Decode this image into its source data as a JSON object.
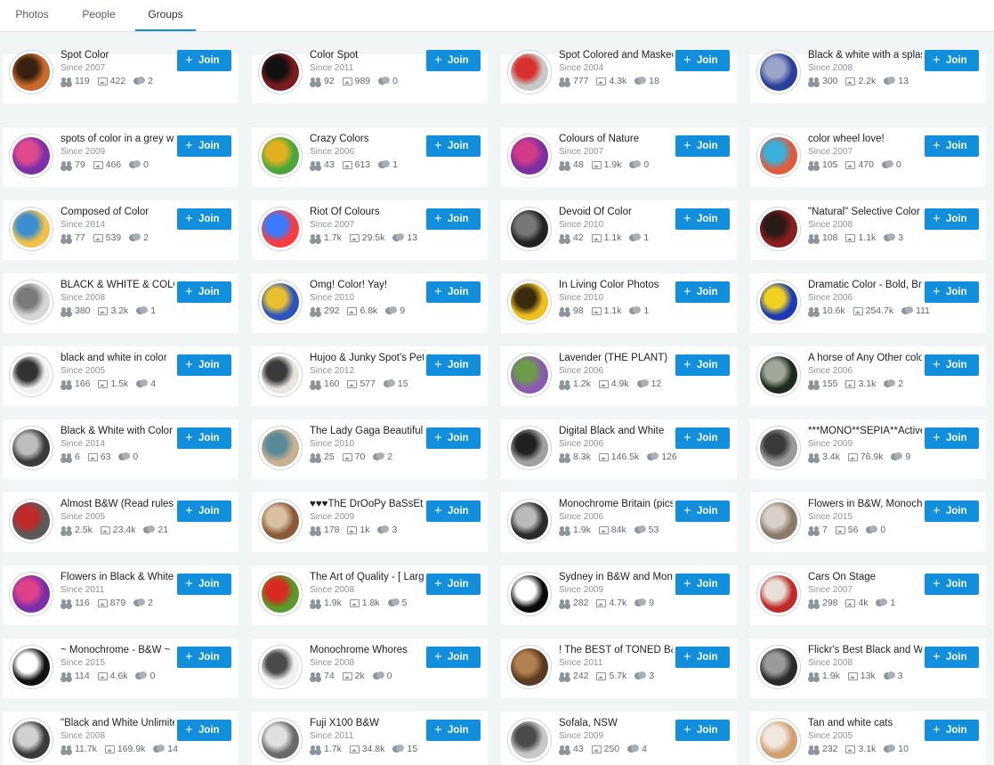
{
  "tabs": [
    {
      "label": "Photos",
      "active": false
    },
    {
      "label": "People",
      "active": false
    },
    {
      "label": "Groups",
      "active": true
    }
  ],
  "join_label": "Join",
  "accent_color": "#128fdc",
  "groups": [
    {
      "name": "Spot Color",
      "since": "Since 2007",
      "members": "119",
      "photos": "422",
      "discussions": "2",
      "avatar": [
        "#c96a2a",
        "#3a2010"
      ]
    },
    {
      "name": "Color Spot",
      "since": "Since 2011",
      "members": "92",
      "photos": "989",
      "discussions": "0",
      "avatar": [
        "#7a1c1c",
        "#111111"
      ]
    },
    {
      "name": "Spot Colored and Masked",
      "since": "Since 2004",
      "members": "777",
      "photos": "4.3k",
      "discussions": "18",
      "avatar": [
        "#c8c8c8",
        "#d8302f"
      ]
    },
    {
      "name": "Black & white with a splash",
      "since": "Since 2008",
      "members": "300",
      "photos": "2.2k",
      "discussions": "13",
      "avatar": [
        "#2a3f9a",
        "#9aa3c8"
      ]
    },
    {
      "name": "spots of color in a grey world",
      "since": "Since 2009",
      "members": "79",
      "photos": "466",
      "discussions": "0",
      "avatar": [
        "#7b2fa8",
        "#e04c8b"
      ]
    },
    {
      "name": "Crazy Colors",
      "since": "Since 2006",
      "members": "43",
      "photos": "613",
      "discussions": "1",
      "avatar": [
        "#4aa83a",
        "#e0b020"
      ]
    },
    {
      "name": "Colours of Nature",
      "since": "Since 2007",
      "members": "48",
      "photos": "1.9k",
      "discussions": "0",
      "avatar": [
        "#7a2fa0",
        "#d23a8a"
      ]
    },
    {
      "name": "color wheel love!",
      "since": "Since 2007",
      "members": "105",
      "photos": "470",
      "discussions": "0",
      "avatar": [
        "#e25a3a",
        "#3ab0d8"
      ]
    },
    {
      "name": "Composed of Color",
      "since": "Since 2014",
      "members": "77",
      "photos": "539",
      "discussions": "2",
      "avatar": [
        "#f2c14a",
        "#3b8fd0"
      ]
    },
    {
      "name": "Riot Of Colours",
      "since": "Since 2007",
      "members": "1.7k",
      "photos": "29.5k",
      "discussions": "13",
      "avatar": [
        "#ff3b3b",
        "#3b7bff"
      ]
    },
    {
      "name": "Devoid Of Color",
      "since": "Since 2010",
      "members": "42",
      "photos": "1.1k",
      "discussions": "1",
      "avatar": [
        "#222222",
        "#777777"
      ]
    },
    {
      "name": "\"Natural\" Selective Color",
      "since": "Since 2008",
      "members": "108",
      "photos": "1.1k",
      "discussions": "3",
      "avatar": [
        "#8a1e1e",
        "#2a1a14"
      ]
    },
    {
      "name": "BLACK & WHITE & COLOR",
      "since": "Since 2008",
      "members": "380",
      "photos": "3.2k",
      "discussions": "1",
      "avatar": [
        "#d6d6d6",
        "#7a7a7a"
      ]
    },
    {
      "name": "Omg! Color! Yay!",
      "since": "Since 2010",
      "members": "292",
      "photos": "6.8k",
      "discussions": "9",
      "avatar": [
        "#2a55c0",
        "#e8c030"
      ]
    },
    {
      "name": "In Living Color Photos",
      "since": "Since 2010",
      "members": "98",
      "photos": "1.1k",
      "discussions": "1",
      "avatar": [
        "#f0c020",
        "#3a2a10"
      ]
    },
    {
      "name": "Dramatic Color - Bold, Bright",
      "since": "Since 2006",
      "members": "10.6k",
      "photos": "254.7k",
      "discussions": "111",
      "avatar": [
        "#1a3ab8",
        "#f0d020"
      ]
    },
    {
      "name": "black and white in color",
      "since": "Since 2005",
      "members": "166",
      "photos": "1.5k",
      "discussions": "4",
      "avatar": [
        "#f0f0f0",
        "#333333"
      ]
    },
    {
      "name": "Hujoo & Junky Spot's Pets",
      "since": "Since 2012",
      "members": "160",
      "photos": "577",
      "discussions": "15",
      "avatar": [
        "#e8e4e0",
        "#3a3a3a"
      ]
    },
    {
      "name": "Lavender (THE PLANT)",
      "since": "Since 2006",
      "members": "1.2k",
      "photos": "4.9k",
      "discussions": "12",
      "avatar": [
        "#8a5ab0",
        "#6a9a4a"
      ]
    },
    {
      "name": "A horse of Any Other color",
      "since": "Since 2006",
      "members": "155",
      "photos": "3.1k",
      "discussions": "2",
      "avatar": [
        "#1e2a1e",
        "#a0a89a"
      ]
    },
    {
      "name": "Black & White with Color",
      "since": "Since 2014",
      "members": "6",
      "photos": "63",
      "discussions": "0",
      "avatar": [
        "#3a3a3a",
        "#bdbdbd"
      ]
    },
    {
      "name": "The Lady Gaga Beautiful",
      "since": "Since 2010",
      "members": "25",
      "photos": "70",
      "discussions": "2",
      "avatar": [
        "#c9b090",
        "#5a8a9a"
      ]
    },
    {
      "name": "Digital Black and White",
      "since": "Since 2006",
      "members": "8.3k",
      "photos": "146.5k",
      "discussions": "126",
      "avatar": [
        "#a0a0a0",
        "#202020"
      ]
    },
    {
      "name": "***MONO**SEPIA**Active",
      "since": "Since 2009",
      "members": "3.4k",
      "photos": "76.9k",
      "discussions": "9",
      "avatar": [
        "#9a9a9a",
        "#3a3a3a"
      ]
    },
    {
      "name": "Almost B&W (Read rules)",
      "since": "Since 2005",
      "members": "2.5k",
      "photos": "23.4k",
      "discussions": "21",
      "avatar": [
        "#5a5a5a",
        "#c02a2a"
      ]
    },
    {
      "name": "♥♥♥ThE DrOoPy BaSsEtS",
      "since": "Since 2009",
      "members": "178",
      "photos": "1k",
      "discussions": "3",
      "avatar": [
        "#8a5a3a",
        "#d8c0a0"
      ]
    },
    {
      "name": "Monochrome Britain (pics)",
      "since": "Since 2006",
      "members": "1.9k",
      "photos": "84k",
      "discussions": "53",
      "avatar": [
        "#2a2a2a",
        "#bababa"
      ]
    },
    {
      "name": "Flowers in B&W, Monochrome",
      "since": "Since 2015",
      "members": "7",
      "photos": "56",
      "discussions": "0",
      "avatar": [
        "#8a7a6a",
        "#d8d0c8"
      ]
    },
    {
      "name": "Flowers in Black & White",
      "since": "Since 2011",
      "members": "116",
      "photos": "879",
      "discussions": "2",
      "avatar": [
        "#7a2fa8",
        "#e0408a"
      ]
    },
    {
      "name": "The Art of Quality - [ Large ]",
      "since": "Since 2008",
      "members": "1.9k",
      "photos": "1.8k",
      "discussions": "5",
      "avatar": [
        "#5a9a2a",
        "#d82a20"
      ]
    },
    {
      "name": "Sydney in B&W and Mono",
      "since": "Since 2009",
      "members": "282",
      "photos": "4.7k",
      "discussions": "9",
      "avatar": [
        "#0a0a0a",
        "#ffffff"
      ]
    },
    {
      "name": "Cars On Stage",
      "since": "Since 2007",
      "members": "298",
      "photos": "4k",
      "discussions": "1",
      "avatar": [
        "#c02a2a",
        "#e8e0d8"
      ]
    },
    {
      "name": "~ Monochrome - B&W ~",
      "since": "Since 2015",
      "members": "114",
      "photos": "4.6k",
      "discussions": "0",
      "avatar": [
        "#111111",
        "#ffffff"
      ]
    },
    {
      "name": "Monochrome Whores",
      "since": "Since 2008",
      "members": "74",
      "photos": "2k",
      "discussions": "0",
      "avatar": [
        "#f0f0f0",
        "#4a4a4a"
      ]
    },
    {
      "name": "! The BEST of TONED B&W",
      "since": "Since 2011",
      "members": "242",
      "photos": "5.7k",
      "discussions": "3",
      "avatar": [
        "#5a3a20",
        "#b08050"
      ]
    },
    {
      "name": "Flickr's Best Black and White",
      "since": "Since 2008",
      "members": "1.9k",
      "photos": "13k",
      "discussions": "3",
      "avatar": [
        "#2a2a2a",
        "#9a9a9a"
      ]
    },
    {
      "name": "\"Black and White Unlimited\"",
      "since": "Since 2008",
      "members": "11.7k",
      "photos": "169.9k",
      "discussions": "14",
      "avatar": [
        "#3a3a3a",
        "#d0d0d0"
      ]
    },
    {
      "name": "Fuji X100 B&W",
      "since": "Since 2011",
      "members": "1.7k",
      "photos": "34.8k",
      "discussions": "15",
      "avatar": [
        "#6a6a6a",
        "#e0e0e0"
      ]
    },
    {
      "name": "Sofala, NSW",
      "since": "Since 2009",
      "members": "43",
      "photos": "250",
      "discussions": "4",
      "avatar": [
        "#c8c8c8",
        "#4a4a4a"
      ]
    },
    {
      "name": "Tan and white cats",
      "since": "Since 2005",
      "members": "232",
      "photos": "3.1k",
      "discussions": "10",
      "avatar": [
        "#d0a070",
        "#f0e8e0"
      ]
    }
  ]
}
